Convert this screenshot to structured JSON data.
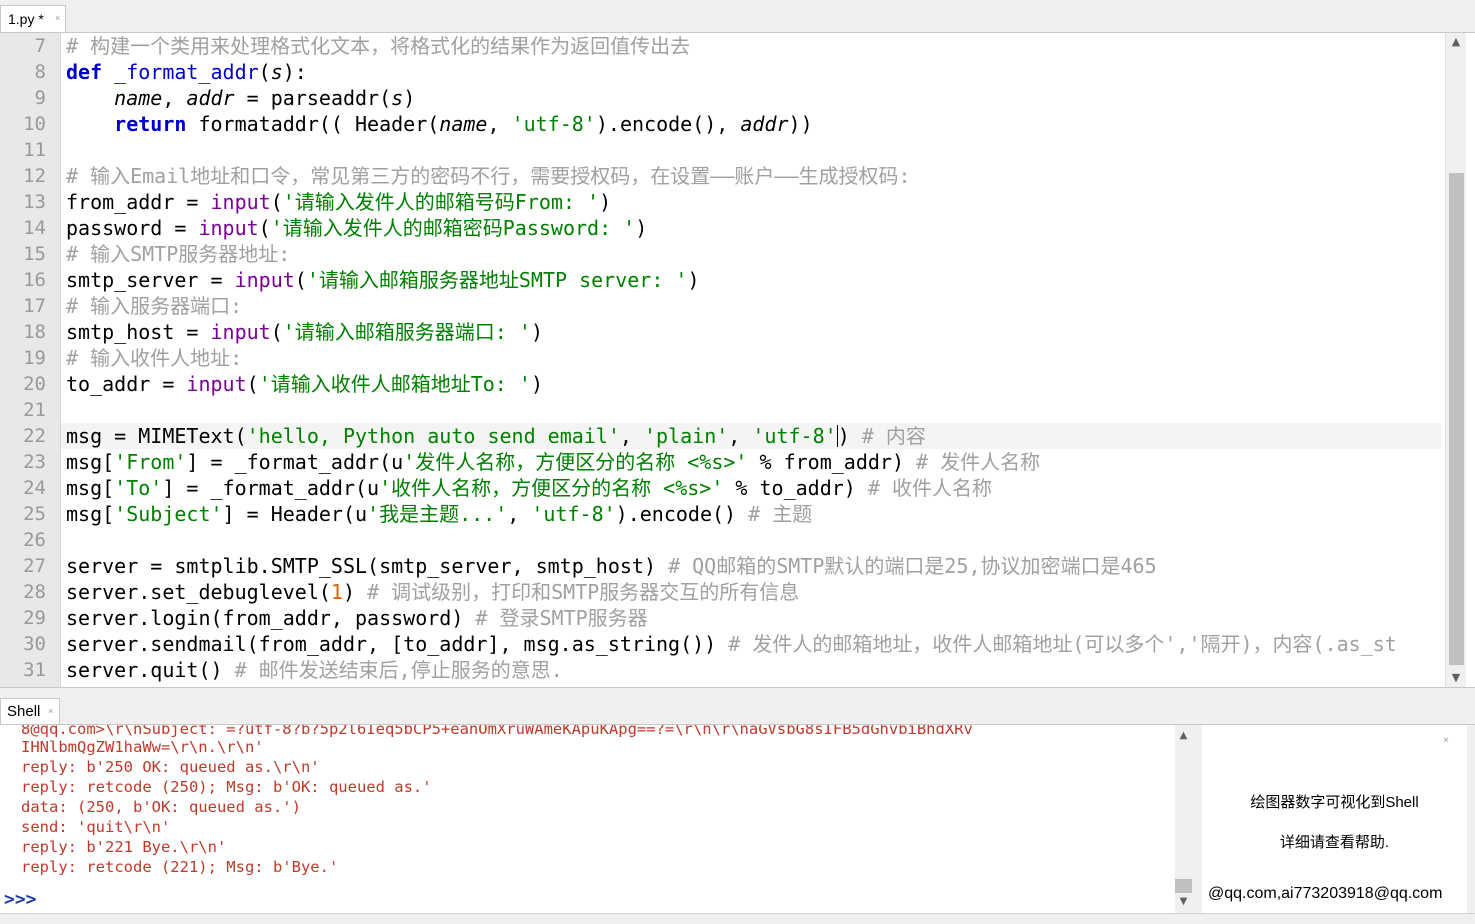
{
  "editor_tab": {
    "title": "1.py *",
    "close": "×"
  },
  "editor": {
    "line_numbers": [
      "7",
      "8",
      "9",
      "10",
      "11",
      "12",
      "13",
      "14",
      "15",
      "16",
      "17",
      "18",
      "19",
      "20",
      "21",
      "22",
      "23",
      "24",
      "25",
      "26",
      "27",
      "28",
      "29",
      "30",
      "31"
    ],
    "lines": [
      [
        {
          "t": "# 构建一个类用来处理格式化文本，将格式化的结果作为返回值传出去",
          "c": "cm"
        }
      ],
      [
        {
          "t": "def",
          "c": "kw"
        },
        {
          "t": " "
        },
        {
          "t": "_format_addr",
          "c": "fn"
        },
        {
          "t": "("
        },
        {
          "t": "s",
          "c": "it"
        },
        {
          "t": "):"
        }
      ],
      [
        {
          "t": "    "
        },
        {
          "t": "name",
          "c": "it"
        },
        {
          "t": ", "
        },
        {
          "t": "addr",
          "c": "it"
        },
        {
          "t": " = parseaddr("
        },
        {
          "t": "s",
          "c": "it"
        },
        {
          "t": ")"
        }
      ],
      [
        {
          "t": "    "
        },
        {
          "t": "return",
          "c": "kw"
        },
        {
          "t": " formataddr(( Header("
        },
        {
          "t": "name",
          "c": "it"
        },
        {
          "t": ", "
        },
        {
          "t": "'utf-8'",
          "c": "str"
        },
        {
          "t": ").encode(), "
        },
        {
          "t": "addr",
          "c": "it"
        },
        {
          "t": "))"
        }
      ],
      [],
      [
        {
          "t": "# 输入Email地址和口令，常见第三方的密码不行，需要授权码，在设置——账户——生成授权码:",
          "c": "cm"
        }
      ],
      [
        {
          "t": "from_addr = "
        },
        {
          "t": "input",
          "c": "bi"
        },
        {
          "t": "("
        },
        {
          "t": "'请输入发件人的邮箱号码From: '",
          "c": "str"
        },
        {
          "t": ")"
        }
      ],
      [
        {
          "t": "password = "
        },
        {
          "t": "input",
          "c": "bi"
        },
        {
          "t": "("
        },
        {
          "t": "'请输入发件人的邮箱密码Password: '",
          "c": "str"
        },
        {
          "t": ")"
        }
      ],
      [
        {
          "t": "# 输入SMTP服务器地址:",
          "c": "cm"
        }
      ],
      [
        {
          "t": "smtp_server = "
        },
        {
          "t": "input",
          "c": "bi"
        },
        {
          "t": "("
        },
        {
          "t": "'请输入邮箱服务器地址SMTP server: '",
          "c": "str"
        },
        {
          "t": ")"
        }
      ],
      [
        {
          "t": "# 输入服务器端口:",
          "c": "cm"
        }
      ],
      [
        {
          "t": "smtp_host = "
        },
        {
          "t": "input",
          "c": "bi"
        },
        {
          "t": "("
        },
        {
          "t": "'请输入邮箱服务器端口: '",
          "c": "str"
        },
        {
          "t": ")"
        }
      ],
      [
        {
          "t": "# 输入收件人地址:",
          "c": "cm"
        }
      ],
      [
        {
          "t": "to_addr = "
        },
        {
          "t": "input",
          "c": "bi"
        },
        {
          "t": "("
        },
        {
          "t": "'请输入收件人邮箱地址To: '",
          "c": "str"
        },
        {
          "t": ")"
        }
      ],
      [],
      [
        {
          "t": "msg = MIMEText("
        },
        {
          "t": "'hello, Python auto send email'",
          "c": "str"
        },
        {
          "t": ", "
        },
        {
          "t": "'plain'",
          "c": "str"
        },
        {
          "t": ", "
        },
        {
          "t": "'utf-8'",
          "c": "str"
        },
        {
          "t": "",
          "c": "caret"
        },
        {
          "t": ") "
        },
        {
          "t": "# 内容",
          "c": "cm"
        }
      ],
      [
        {
          "t": "msg["
        },
        {
          "t": "'From'",
          "c": "str"
        },
        {
          "t": "] = _format_addr(u"
        },
        {
          "t": "'发件人名称，方便区分的名称 <%s>'",
          "c": "str"
        },
        {
          "t": " % from_addr) "
        },
        {
          "t": "# 发件人名称",
          "c": "cm"
        }
      ],
      [
        {
          "t": "msg["
        },
        {
          "t": "'To'",
          "c": "str"
        },
        {
          "t": "] = _format_addr(u"
        },
        {
          "t": "'收件人名称，方便区分的名称 <%s>'",
          "c": "str"
        },
        {
          "t": " % to_addr) "
        },
        {
          "t": "# 收件人名称",
          "c": "cm"
        }
      ],
      [
        {
          "t": "msg["
        },
        {
          "t": "'Subject'",
          "c": "str"
        },
        {
          "t": "] = Header(u"
        },
        {
          "t": "'我是主题...'",
          "c": "str"
        },
        {
          "t": ", "
        },
        {
          "t": "'utf-8'",
          "c": "str"
        },
        {
          "t": ").encode() "
        },
        {
          "t": "# 主题",
          "c": "cm"
        }
      ],
      [],
      [
        {
          "t": "server = smtplib.SMTP_SSL(smtp_server, smtp_host) "
        },
        {
          "t": "# QQ邮箱的SMTP默认的端口是25,协议加密端口是465",
          "c": "cm"
        }
      ],
      [
        {
          "t": "server.set_debuglevel("
        },
        {
          "t": "1",
          "c": "num"
        },
        {
          "t": ") "
        },
        {
          "t": "# 调试级别，打印和SMTP服务器交互的所有信息",
          "c": "cm"
        }
      ],
      [
        {
          "t": "server.login(from_addr, password) "
        },
        {
          "t": "# 登录SMTP服务器",
          "c": "cm"
        }
      ],
      [
        {
          "t": "server.sendmail(from_addr, [to_addr], msg.as_string()) "
        },
        {
          "t": "# 发件人的邮箱地址，收件人邮箱地址(可以多个','隔开)，内容(.as_st",
          "c": "cm"
        }
      ],
      [
        {
          "t": "server.quit() "
        },
        {
          "t": "# 邮件发送结束后,停止服务的意思.",
          "c": "cm"
        }
      ]
    ],
    "current_line_index": 15
  },
  "shell_tab": {
    "title": "Shell",
    "close": "×"
  },
  "shell": {
    "lines": [
      "8@qq.com>\\r\\nSubject: =?utf-8?b?5p2l6Ieq5bCP5+eanOmXruWAmeKApuKApg==?=\\r\\n\\r\\naGVsbG8sIFB5dGhvbiBhdXRv",
      "IHNlbmQgZW1haWw=\\r\\n.\\r\\n'",
      "reply: b'250 OK: queued as.\\r\\n'",
      "reply: retcode (250); Msg: b'OK: queued as.'",
      "data: (250, b'OK: queued as.')",
      "send: 'quit\\r\\n'",
      "reply: b'221 Bye.\\r\\n'",
      "reply: retcode (221); Msg: b'Bye.'"
    ],
    "prompt": ">>>"
  },
  "assistant": {
    "close": "×",
    "tip1": "绘图器数字可视化到Shell",
    "tip2": "详细请查看帮助.",
    "tail": "@qq.com,ai773203918@qq.com"
  }
}
